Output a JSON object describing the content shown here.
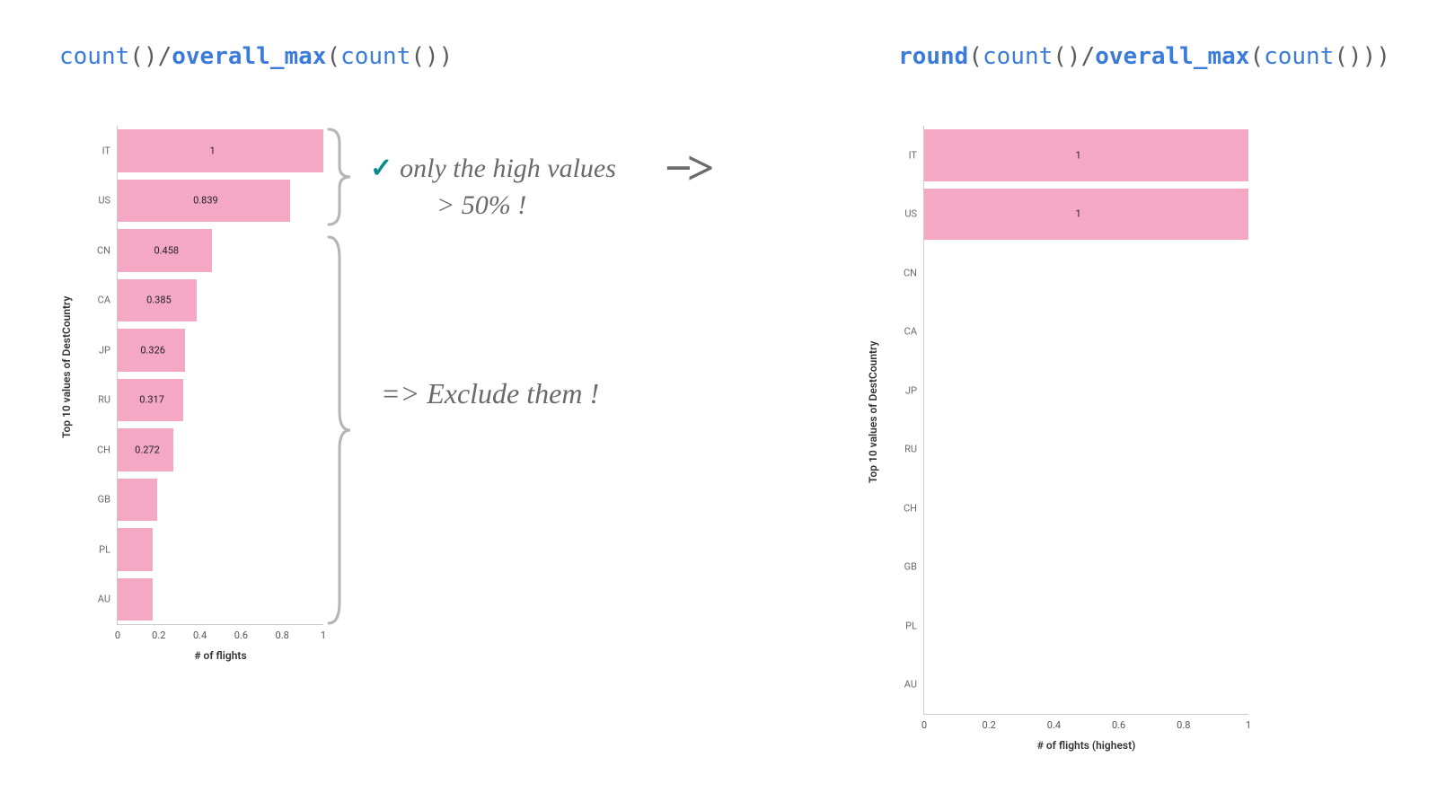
{
  "left_formula": {
    "parts": [
      {
        "text": "count",
        "cls": "fn"
      },
      {
        "text": "()/",
        "cls": "pun"
      },
      {
        "text": "overall_max",
        "cls": "fn bold"
      },
      {
        "text": "(",
        "cls": "pun"
      },
      {
        "text": "count",
        "cls": "fn"
      },
      {
        "text": "())",
        "cls": "pun"
      }
    ]
  },
  "right_formula": {
    "parts": [
      {
        "text": "round",
        "cls": "fn bold"
      },
      {
        "text": "(",
        "cls": "pun"
      },
      {
        "text": "count",
        "cls": "fn"
      },
      {
        "text": "()/",
        "cls": "pun"
      },
      {
        "text": "overall_max",
        "cls": "fn bold"
      },
      {
        "text": "(",
        "cls": "pun"
      },
      {
        "text": "count",
        "cls": "fn"
      },
      {
        "text": "()))",
        "cls": "pun"
      }
    ]
  },
  "annotations": {
    "high_line1": "only the high values",
    "high_line2": "> 50% !",
    "exclude": "=> Exclude them !",
    "arrow": "−>"
  },
  "chart_data": [
    {
      "id": "left",
      "type": "bar",
      "orientation": "horizontal",
      "ylabel": "Top 10 values of DestCountry",
      "xlabel": "# of flights",
      "xlim": [
        0,
        1
      ],
      "xticks": [
        0,
        0.2,
        0.4,
        0.6,
        0.8,
        1
      ],
      "categories": [
        "IT",
        "US",
        "CN",
        "CA",
        "JP",
        "RU",
        "CH",
        "GB",
        "PL",
        "AU"
      ],
      "values": [
        1,
        0.839,
        0.458,
        0.385,
        0.326,
        0.317,
        0.272,
        0.19,
        0.17,
        0.17
      ],
      "bar_labels": [
        "1",
        "0.839",
        "0.458",
        "0.385",
        "0.326",
        "0.317",
        "0.272",
        "",
        "",
        ""
      ]
    },
    {
      "id": "right",
      "type": "bar",
      "orientation": "horizontal",
      "ylabel": "Top 10 values of DestCountry",
      "xlabel": "# of flights (highest)",
      "xlim": [
        0,
        1
      ],
      "xticks": [
        0,
        0.2,
        0.4,
        0.6,
        0.8,
        1
      ],
      "categories": [
        "IT",
        "US",
        "CN",
        "CA",
        "JP",
        "RU",
        "CH",
        "GB",
        "PL",
        "AU"
      ],
      "values": [
        1,
        1,
        0,
        0,
        0,
        0,
        0,
        0,
        0,
        0
      ],
      "bar_labels": [
        "1",
        "1",
        "",
        "",
        "",
        "",
        "",
        "",
        "",
        ""
      ]
    }
  ],
  "colors": {
    "bar": "#f5a8c3",
    "fn": "#3b7bd9",
    "check": "#0a8a8a"
  }
}
